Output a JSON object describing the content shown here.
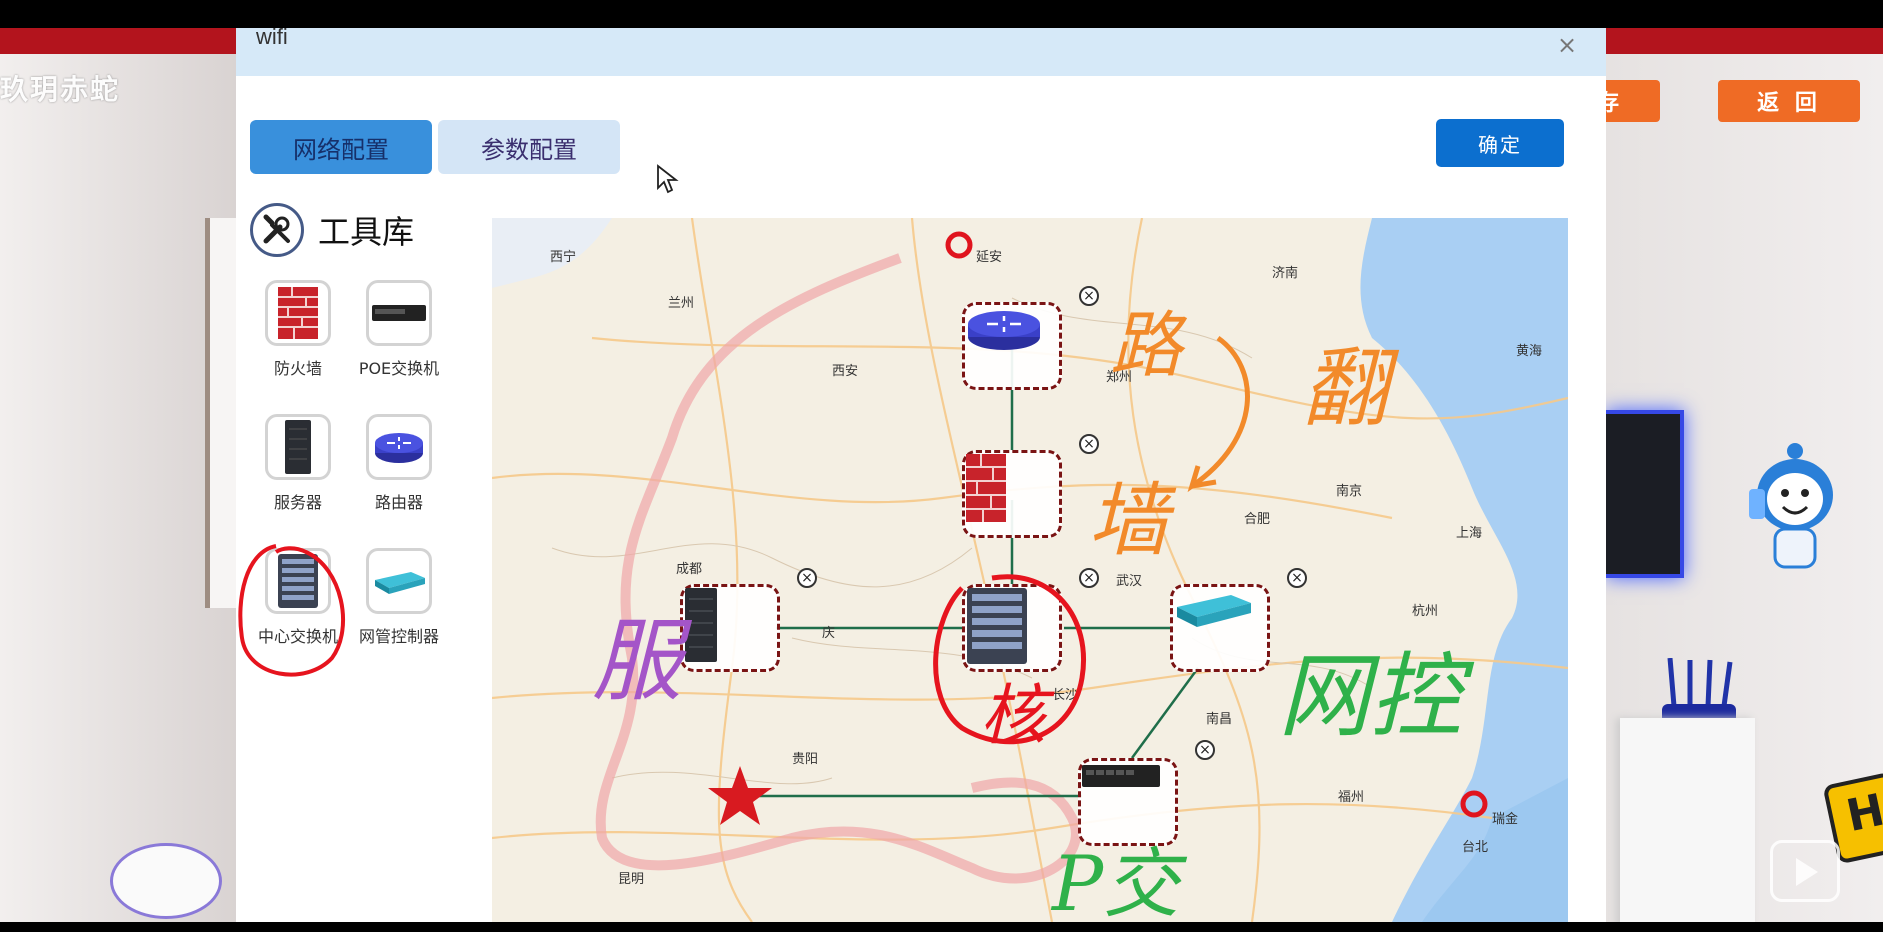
{
  "background": {
    "logo_text": "玖玥赤蛇",
    "save_button": "存",
    "back_button": "返 回",
    "badge_letter": "H"
  },
  "modal": {
    "title": "wifi",
    "close_glyph": "×",
    "tabs": [
      {
        "label": "网络配置",
        "active": true
      },
      {
        "label": "参数配置",
        "active": false
      }
    ],
    "confirm_label": "确定"
  },
  "toolbox": {
    "title": "工具库",
    "tools": [
      {
        "label": "防火墙",
        "icon": "firewall-icon"
      },
      {
        "label": "POE交换机",
        "icon": "poe-switch-icon"
      },
      {
        "label": "服务器",
        "icon": "server-icon"
      },
      {
        "label": "路由器",
        "icon": "router-icon"
      },
      {
        "label": "中心交换机",
        "icon": "core-switch-icon"
      },
      {
        "label": "网管控制器",
        "icon": "network-controller-icon"
      }
    ]
  },
  "map": {
    "cities": [
      "西宁",
      "延安",
      "济南",
      "兰州",
      "西安",
      "郑州",
      "黄海",
      "南京",
      "合肥",
      "上海",
      "成都",
      "武汉",
      "杭州",
      "庆",
      "长沙",
      "南昌",
      "贵阳",
      "福州",
      "瑞金",
      "台北",
      "昆明"
    ],
    "nodes": [
      "router",
      "firewall",
      "server",
      "core-switch",
      "network-controller",
      "poe-switch"
    ],
    "delete_glyph": "×"
  },
  "annotations": {
    "router": "路",
    "turn": "翻",
    "firewall": "墙",
    "server": "服",
    "core_switch": "核",
    "controller": "网控",
    "poe": "P交"
  },
  "colors": {
    "primary_button": "#0c6fcf",
    "active_tab": "#3990dc",
    "inactive_tab": "#d4e5f6",
    "header_bg": "#d6e9f8",
    "node_border": "#7a1414",
    "link_line": "#1f6e4a",
    "annot_orange": "#f28a2a",
    "annot_purple": "#a455c8",
    "annot_red": "#e6141e",
    "annot_green": "#2fb14a"
  }
}
